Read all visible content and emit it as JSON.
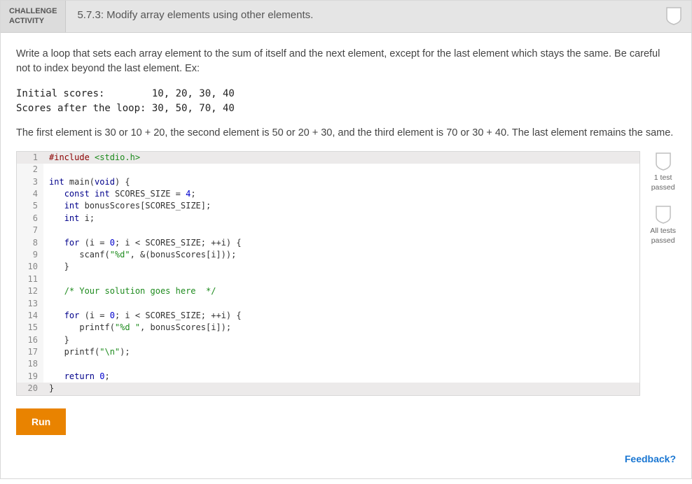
{
  "header": {
    "label1": "CHALLENGE",
    "label2": "ACTIVITY",
    "title": "5.7.3: Modify array elements using other elements."
  },
  "prompt": {
    "p1": "Write a loop that sets each array element to the sum of itself and the next element, except for the last element which stays the same. Be careful not to index beyond the last element. Ex:",
    "ex": "Initial scores:        10, 20, 30, 40\nScores after the loop: 30, 50, 70, 40",
    "p2": "The first element is 30 or 10 + 20, the second element is 50 or 20 + 30, and the third element is 70 or 30 + 40. The last element remains the same."
  },
  "code": [
    {
      "n": 1,
      "hl": true,
      "tokens": [
        {
          "c": "pp",
          "t": "#include "
        },
        {
          "c": "str",
          "t": "<stdio.h>"
        }
      ]
    },
    {
      "n": 2,
      "tokens": []
    },
    {
      "n": 3,
      "tokens": [
        {
          "c": "ty",
          "t": "int"
        },
        {
          "t": " main("
        },
        {
          "c": "ty",
          "t": "void"
        },
        {
          "t": ") {"
        }
      ]
    },
    {
      "n": 4,
      "tokens": [
        {
          "t": "   "
        },
        {
          "c": "kw",
          "t": "const"
        },
        {
          "t": " "
        },
        {
          "c": "ty",
          "t": "int"
        },
        {
          "t": " SCORES_SIZE = "
        },
        {
          "c": "num",
          "t": "4"
        },
        {
          "t": ";"
        }
      ]
    },
    {
      "n": 5,
      "tokens": [
        {
          "t": "   "
        },
        {
          "c": "ty",
          "t": "int"
        },
        {
          "t": " bonusScores[SCORES_SIZE];"
        }
      ]
    },
    {
      "n": 6,
      "tokens": [
        {
          "t": "   "
        },
        {
          "c": "ty",
          "t": "int"
        },
        {
          "t": " i;"
        }
      ]
    },
    {
      "n": 7,
      "tokens": []
    },
    {
      "n": 8,
      "tokens": [
        {
          "t": "   "
        },
        {
          "c": "kw",
          "t": "for"
        },
        {
          "t": " (i = "
        },
        {
          "c": "num",
          "t": "0"
        },
        {
          "t": "; i < SCORES_SIZE; ++i) {"
        }
      ]
    },
    {
      "n": 9,
      "tokens": [
        {
          "t": "      scanf("
        },
        {
          "c": "str",
          "t": "\"%d\""
        },
        {
          "t": ", &(bonusScores[i]));"
        }
      ]
    },
    {
      "n": 10,
      "tokens": [
        {
          "t": "   }"
        }
      ]
    },
    {
      "n": 11,
      "tokens": []
    },
    {
      "n": 12,
      "tokens": [
        {
          "t": "   "
        },
        {
          "c": "cm",
          "t": "/* Your solution goes here  */"
        }
      ]
    },
    {
      "n": 13,
      "tokens": []
    },
    {
      "n": 14,
      "tokens": [
        {
          "t": "   "
        },
        {
          "c": "kw",
          "t": "for"
        },
        {
          "t": " (i = "
        },
        {
          "c": "num",
          "t": "0"
        },
        {
          "t": "; i < SCORES_SIZE; ++i) {"
        }
      ]
    },
    {
      "n": 15,
      "tokens": [
        {
          "t": "      printf("
        },
        {
          "c": "str",
          "t": "\"%d \""
        },
        {
          "t": ", bonusScores[i]);"
        }
      ]
    },
    {
      "n": 16,
      "tokens": [
        {
          "t": "   }"
        }
      ]
    },
    {
      "n": 17,
      "tokens": [
        {
          "t": "   printf("
        },
        {
          "c": "str",
          "t": "\"\\n\""
        },
        {
          "t": ");"
        }
      ]
    },
    {
      "n": 18,
      "tokens": []
    },
    {
      "n": 19,
      "tokens": [
        {
          "t": "   "
        },
        {
          "c": "kw",
          "t": "return"
        },
        {
          "t": " "
        },
        {
          "c": "num",
          "t": "0"
        },
        {
          "t": ";"
        }
      ]
    },
    {
      "n": 20,
      "hl": true,
      "tokens": [
        {
          "t": "}"
        }
      ]
    }
  ],
  "side": {
    "b1a": "1 test",
    "b1b": "passed",
    "b2a": "All tests",
    "b2b": "passed"
  },
  "actions": {
    "run": "Run",
    "feedback": "Feedback?"
  }
}
